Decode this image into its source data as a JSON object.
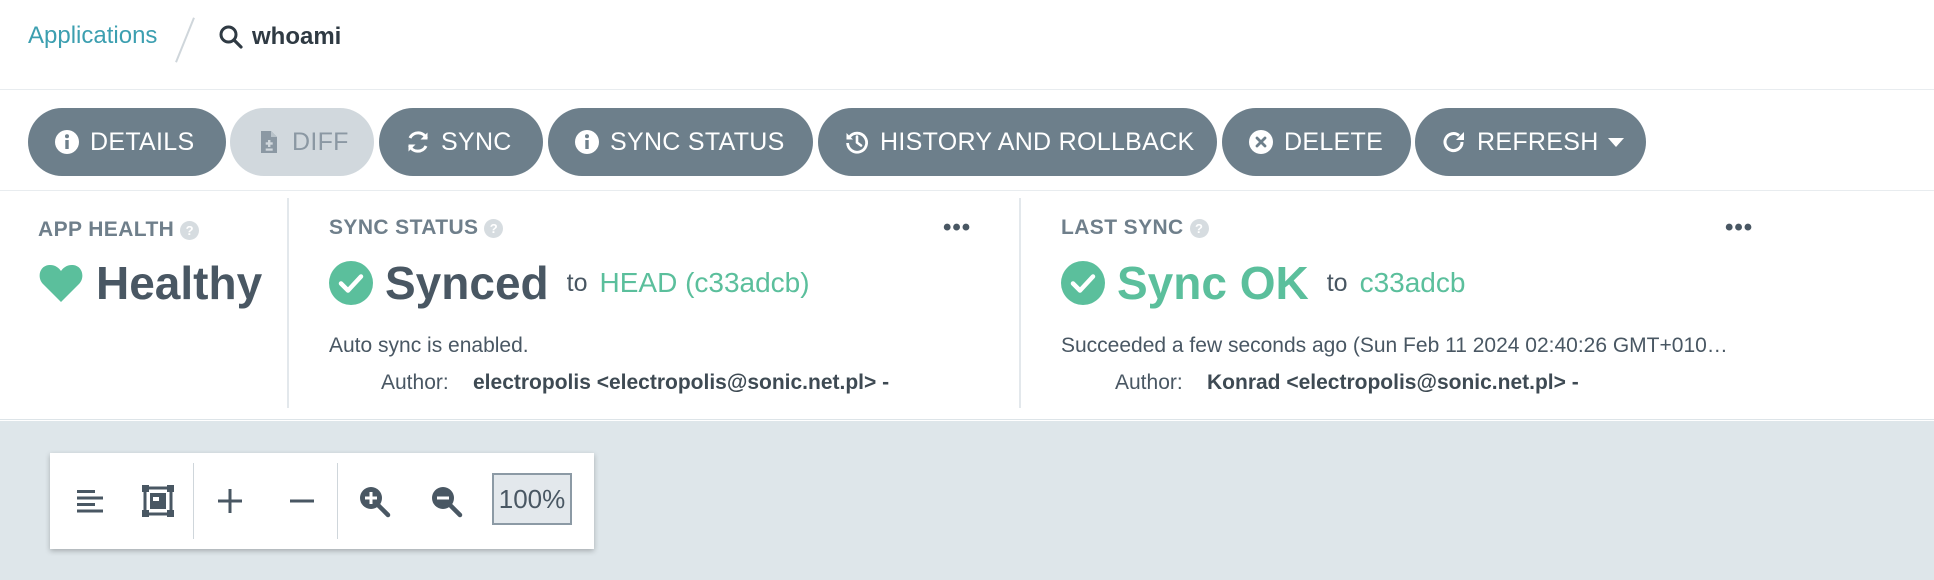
{
  "breadcrumb": {
    "root": "Applications",
    "current": "whoami"
  },
  "toolbar": {
    "details": "DETAILS",
    "diff": "DIFF",
    "sync": "SYNC",
    "sync_status": "SYNC STATUS",
    "history": "HISTORY AND ROLLBACK",
    "delete": "DELETE",
    "refresh": "REFRESH"
  },
  "app_health": {
    "title": "APP HEALTH",
    "value": "Healthy"
  },
  "sync_status": {
    "title": "SYNC STATUS",
    "value": "Synced",
    "to": "to",
    "revision": "HEAD (c33adcb)",
    "message": "Auto sync is enabled.",
    "author_label": "Author:",
    "author": "electropolis <electropolis@sonic.net.pl> -",
    "menu": "•••"
  },
  "last_sync": {
    "title": "LAST SYNC",
    "value": "Sync OK",
    "to": "to",
    "revision": "c33adcb",
    "message": "Succeeded a few seconds ago (Sun Feb 11 2024 02:40:26 GMT+010…",
    "author_label": "Author:",
    "author": "Konrad <electropolis@sonic.net.pl> -",
    "menu": "•••"
  },
  "zoom": {
    "level": "100%"
  },
  "colors": {
    "accent_link": "#3c9fb0",
    "healthy": "#5bbf9c",
    "button": "#6d7f8b",
    "button_disabled": "#d1d8dd",
    "canvas_bg": "#dee6ea"
  },
  "icons": {
    "search": "search-icon",
    "details": "info-circle-icon",
    "diff": "file-diff-icon",
    "sync": "sync-icon",
    "sync_status": "info-circle-icon",
    "history": "history-icon",
    "delete": "times-circle-icon",
    "refresh": "redo-icon",
    "health": "heart-icon",
    "synced": "check-circle-icon"
  }
}
